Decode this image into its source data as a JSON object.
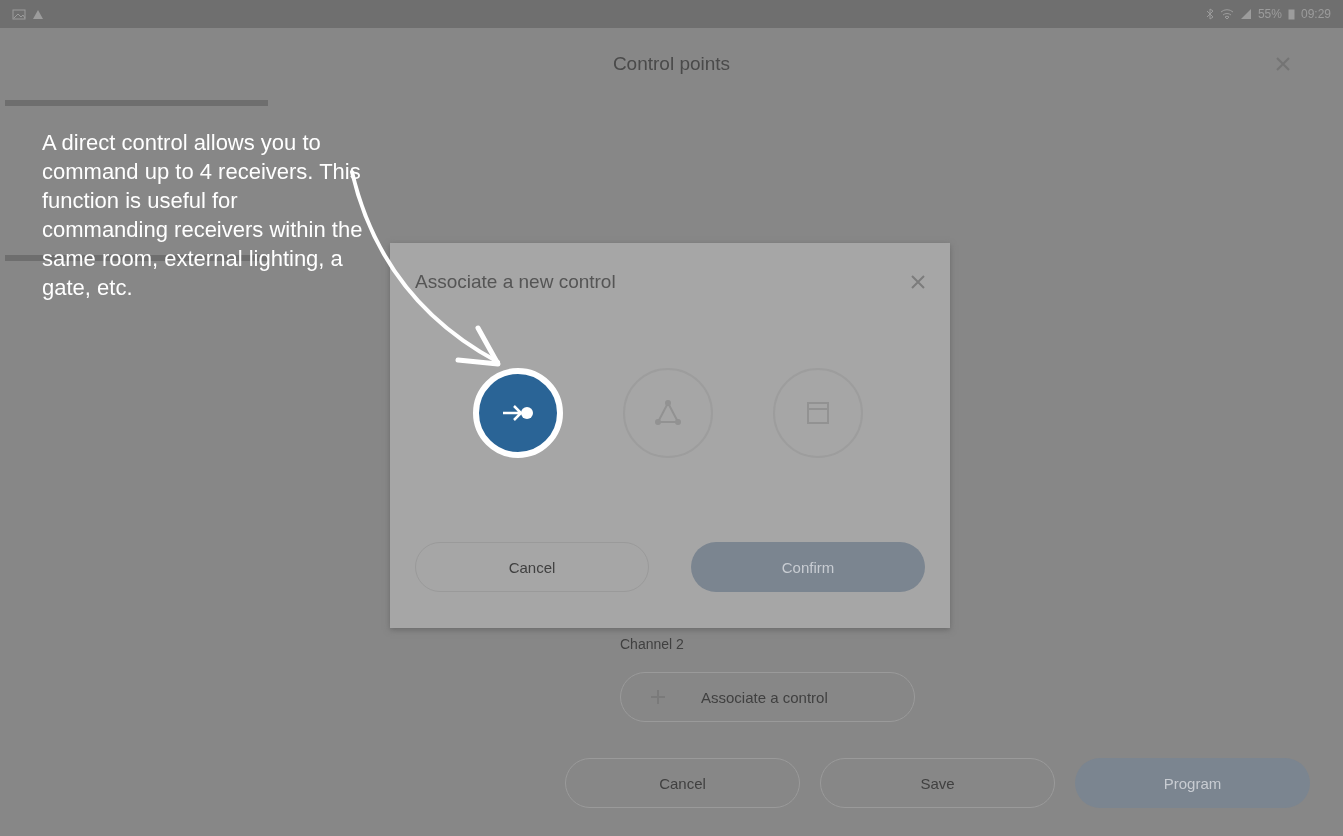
{
  "status_bar": {
    "battery": "55%",
    "time": "09:29"
  },
  "header": {
    "title": "Control points"
  },
  "channel": {
    "label": "Channel 2",
    "button": "Associate a control"
  },
  "footer_buttons": [
    {
      "label": "Cancel",
      "kind": "outline"
    },
    {
      "label": "Save",
      "kind": "outline"
    },
    {
      "label": "Program",
      "kind": "filled"
    }
  ],
  "dialog": {
    "title": "Associate a new control",
    "options": [
      {
        "kind": "direct",
        "selected": true
      },
      {
        "kind": "network",
        "selected": false
      },
      {
        "kind": "window",
        "selected": false
      }
    ],
    "buttons": [
      {
        "label": "Cancel",
        "kind": "outline"
      },
      {
        "label": "Confirm",
        "kind": "filled"
      }
    ]
  },
  "tutorial": {
    "text": "A direct control allows you to command up to 4 receivers. This function is useful for commanding receivers within the same room, external lighting, a gate, etc."
  }
}
